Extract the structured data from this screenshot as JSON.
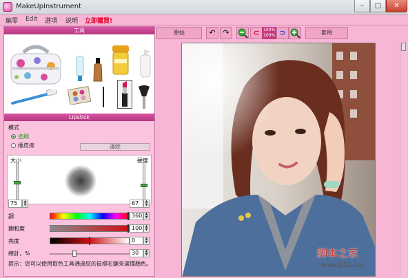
{
  "window": {
    "title": "MakeUpInstrument"
  },
  "menu": [
    {
      "label": "編零"
    },
    {
      "label": "Edit"
    },
    {
      "label": "選項"
    },
    {
      "label": "説明"
    },
    {
      "label": "立即購買!"
    }
  ],
  "left_panel": {
    "tools_header": "工具",
    "lipstick_header": "Lipstick",
    "mode_label": "模式",
    "mode_options": [
      "塗刷",
      "橡皮擦"
    ],
    "clear_button": "清除",
    "size_label": "大小",
    "hardness_label": "硬度",
    "size_value": "75",
    "hardness_value": "67",
    "hue_label": "調",
    "hue_value": "360",
    "saturation_label": "飽和度",
    "saturation_value": "100",
    "brightness_label": "亮度",
    "brightness_value": "0",
    "total_label": "總計，%",
    "total_value": "30",
    "tip": "提示：您可以使用取色工具通過您的鼠標右鍵來選擇顏色。"
  },
  "toolbar": {
    "original_button": "原始",
    "apply_button": "套用",
    "zoom_top": "100%",
    "zoom_bottom": "100%"
  },
  "icons": {
    "undo": "undo-icon",
    "redo": "redo-icon",
    "zoom_out": "zoom-out-icon",
    "zoom_in": "zoom-in-icon",
    "fit": "fit-icon"
  },
  "watermark": {
    "text": "脚本之家",
    "url": "www.jb51.net"
  },
  "colors": {
    "window_bg": "#f8b6d6",
    "header_bar": "#c9478f",
    "menu_highlight": "#e6002a"
  }
}
